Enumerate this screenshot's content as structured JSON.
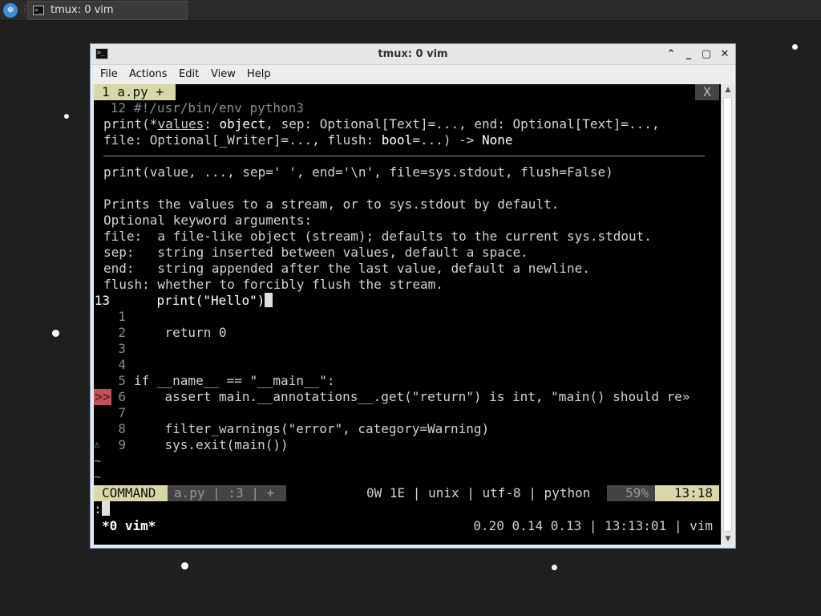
{
  "desktop": {
    "task_label": "tmux: 0 vim"
  },
  "window": {
    "title": "tmux: 0 vim",
    "controls": [
      "minimize-up",
      "maximize",
      "close"
    ]
  },
  "menu": {
    "items": [
      "File",
      "Actions",
      "Edit",
      "View",
      "Help"
    ]
  },
  "vim": {
    "tab": {
      "label": "1 a.py +",
      "close": "X"
    },
    "hover": {
      "first_line_num": "12",
      "first_line_text": "#!/usr/bin/env python3",
      "sig1_a": "print(*",
      "sig1_b": "values",
      "sig1_c": ": ",
      "sig1_d": "object",
      "sig1_e": ", sep: Optional[Text]=..., end: Optional[Text]=...,",
      "sig2_a": "file: Optional[_Writer]=..., flush: ",
      "sig2_b": "bool",
      "sig2_c": "=...) -> ",
      "sig2_d": "None",
      "doc_sig": "print(value, ..., sep=' ', end='\\n', file=sys.stdout, flush=False)",
      "doc_lines": [
        "Prints the values to a stream, or to sys.stdout by default.",
        "Optional keyword arguments:",
        "file:  a file-like object (stream); defaults to the current sys.stdout.",
        "sep:   string inserted between values, default a space.",
        "end:   string appended after the last value, default a newline.",
        "flush: whether to forcibly flush the stream."
      ]
    },
    "code": [
      {
        "num": "13",
        "text": "    print(\"Hello\")"
      },
      {
        "num": "1",
        "text": ""
      },
      {
        "num": "2",
        "text": "    return 0"
      },
      {
        "num": "3",
        "text": ""
      },
      {
        "num": "4",
        "text": ""
      },
      {
        "num": "5",
        "text": "if __name__ == \"__main__\":"
      },
      {
        "num": "6",
        "text": "    assert main.__annotations__.get(\"return\") is int, \"main() should re»"
      },
      {
        "num": "7",
        "text": ""
      },
      {
        "num": "8",
        "text": "    filter_warnings(\"error\", category=Warning)"
      },
      {
        "num": "9",
        "text": "    sys.exit(main())"
      }
    ],
    "signs": {
      "error": ">>",
      "warning": "⚠"
    },
    "tilde": "~",
    "status": {
      "mode": "COMMAND",
      "file": "a.py | :3 | +",
      "info": "0W 1E | unix | utf-8 | python",
      "percent": "59%",
      "position": "13:18"
    },
    "cmdline": ":"
  },
  "tmux": {
    "window": "*0 vim*",
    "right": "0.20 0.14 0.13 | 13:13:01 | vim"
  }
}
